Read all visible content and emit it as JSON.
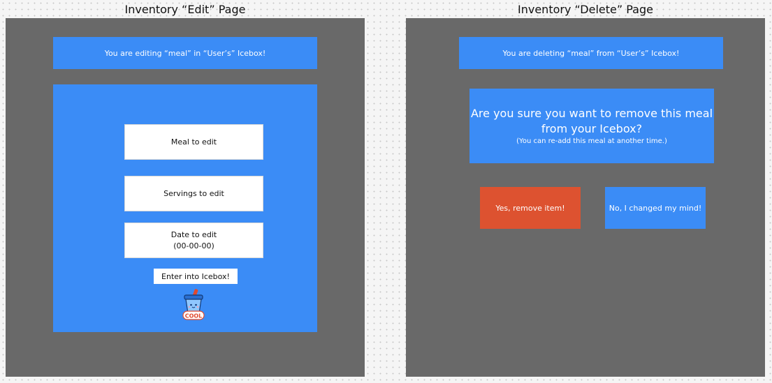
{
  "edit_page": {
    "title": "Inventory “Edit” Page",
    "banner": "You are editing  “meal” in “User’s” Icebox!",
    "meal_field": "Meal to edit",
    "servings_field": "Servings to edit",
    "date_field_line1": "Date to edit",
    "date_field_line2": "(00-00-00)",
    "submit_button": "Enter into Icebox!",
    "mascot_label": "COOL"
  },
  "delete_page": {
    "title": "Inventory “Delete” Page",
    "banner": "You are deleting “meal” from “User’s” Icebox!",
    "confirm_title_line1": "Are you sure you want to remove this meal",
    "confirm_title_line2": "from your Icebox?",
    "confirm_subtitle": "(You can re-add this meal at another time.)",
    "yes_button": "Yes, remove item!",
    "no_button": "No, I changed my mind!"
  },
  "colors": {
    "frame": "#696969",
    "panel": "#3b8cf6",
    "danger": "#dd5230",
    "background": "#f5f5f5"
  }
}
